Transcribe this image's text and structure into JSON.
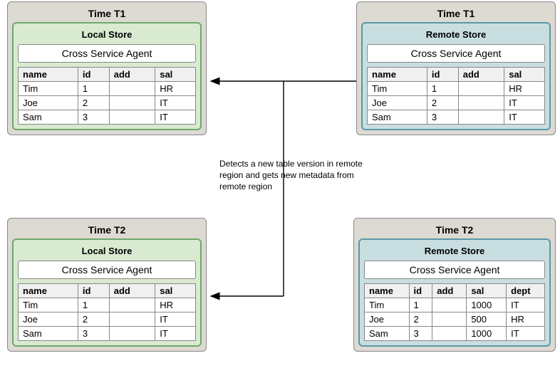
{
  "panels": {
    "t1_local": {
      "title": "Time T1",
      "store_title": "Local Store",
      "agent": "Cross Service Agent"
    },
    "t1_remote": {
      "title": "Time T1",
      "store_title": "Remote Store",
      "agent": "Cross Service Agent"
    },
    "t2_local": {
      "title": "Time T2",
      "store_title": "Local Store",
      "agent": "Cross Service Agent"
    },
    "t2_remote": {
      "title": "Time T2",
      "store_title": "Remote Store",
      "agent": "Cross Service Agent"
    }
  },
  "columns4": {
    "c0": "name",
    "c1": "id",
    "c2": "add",
    "c3": "sal"
  },
  "columns5": {
    "c0": "name",
    "c1": "id",
    "c2": "add",
    "c3": "sal",
    "c4": "dept"
  },
  "t1_local_rows": {
    "r0": {
      "name": "Tim",
      "id": "1",
      "add": "",
      "sal": "HR"
    },
    "r1": {
      "name": "Joe",
      "id": "2",
      "add": "",
      "sal": "IT"
    },
    "r2": {
      "name": "Sam",
      "id": "3",
      "add": "",
      "sal": "IT"
    }
  },
  "t1_remote_rows": {
    "r0": {
      "name": "Tim",
      "id": "1",
      "add": "",
      "sal": "HR"
    },
    "r1": {
      "name": "Joe",
      "id": "2",
      "add": "",
      "sal": "IT"
    },
    "r2": {
      "name": "Sam",
      "id": "3",
      "add": "",
      "sal": "IT"
    }
  },
  "t2_local_rows": {
    "r0": {
      "name": "Tim",
      "id": "1",
      "add": "",
      "sal": "HR"
    },
    "r1": {
      "name": "Joe",
      "id": "2",
      "add": "",
      "sal": "IT"
    },
    "r2": {
      "name": "Sam",
      "id": "3",
      "add": "",
      "sal": "IT"
    }
  },
  "t2_remote_rows": {
    "r0": {
      "name": "Tim",
      "id": "1",
      "add": "",
      "sal": "1000",
      "dept": "IT"
    },
    "r1": {
      "name": "Joe",
      "id": "2",
      "add": "",
      "sal": "500",
      "dept": "HR"
    },
    "r2": {
      "name": "Sam",
      "id": "3",
      "add": "",
      "sal": "1000",
      "dept": "IT"
    }
  },
  "caption": "Detects a new table version in remote region and gets new metadata from remote region"
}
